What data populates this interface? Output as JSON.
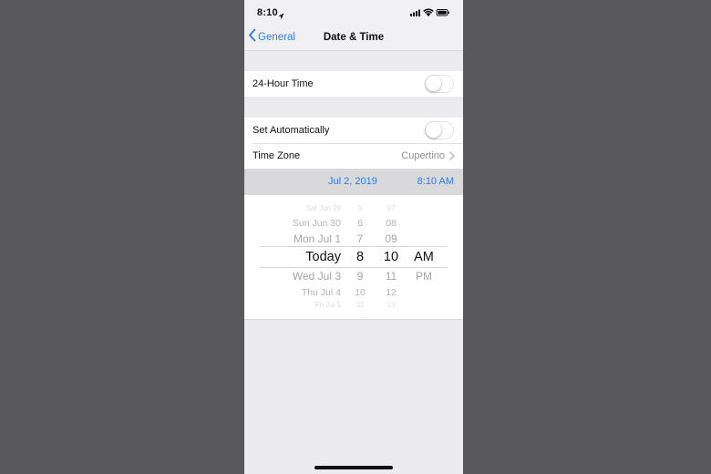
{
  "status_bar": {
    "time": "8:10"
  },
  "nav": {
    "back_label": "General",
    "title": "Date & Time"
  },
  "settings": {
    "hour24": {
      "label": "24-Hour Time",
      "enabled": false
    },
    "set_automatically": {
      "label": "Set Automatically",
      "enabled": false
    },
    "time_zone": {
      "label": "Time Zone",
      "value": "Cupertino"
    }
  },
  "datetime": {
    "date": "Jul 2, 2019",
    "time": "8:10 AM"
  },
  "picker": {
    "dates": [
      "Sat Jun 29",
      "Sun Jun 30",
      "Mon Jul 1",
      "Today",
      "Wed Jul 3",
      "Thu Jul 4",
      "Fri Jul 5"
    ],
    "hours": [
      "5",
      "6",
      "7",
      "8",
      "9",
      "10",
      "11"
    ],
    "minutes": [
      "07",
      "08",
      "09",
      "10",
      "11",
      "12",
      "13"
    ],
    "ampm": [
      "AM",
      "PM"
    ]
  },
  "colors": {
    "accent": "#2f7ae5",
    "background": "#59595b"
  }
}
